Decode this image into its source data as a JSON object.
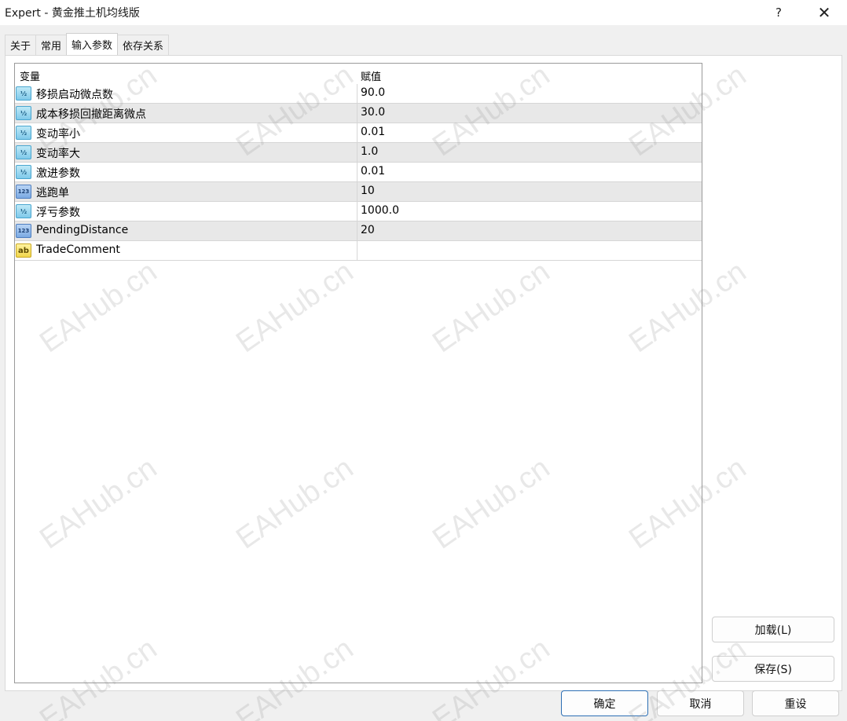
{
  "window": {
    "title": "Expert - 黄金推土机均线版",
    "help_label": "?",
    "close_label": "✕"
  },
  "tabs": [
    {
      "label": "关于"
    },
    {
      "label": "常用"
    },
    {
      "label": "输入参数",
      "active": true
    },
    {
      "label": "依存关系"
    }
  ],
  "grid": {
    "col_variable": "变量",
    "col_value": "赋值",
    "rows": [
      {
        "type": "double",
        "icon": "½",
        "name": "移损启动微点数",
        "value": "90.0"
      },
      {
        "type": "double",
        "icon": "½",
        "name": "成本移损回撤距离微点",
        "value": "30.0"
      },
      {
        "type": "double",
        "icon": "½",
        "name": "变动率小",
        "value": "0.01"
      },
      {
        "type": "double",
        "icon": "½",
        "name": "变动率大",
        "value": "1.0"
      },
      {
        "type": "double",
        "icon": "½",
        "name": "激进参数",
        "value": "0.01"
      },
      {
        "type": "int",
        "icon": "123",
        "name": "逃跑单",
        "value": "10"
      },
      {
        "type": "double",
        "icon": "½",
        "name": "浮亏参数",
        "value": "1000.0"
      },
      {
        "type": "int",
        "icon": "123",
        "name": "PendingDistance",
        "value": "20"
      },
      {
        "type": "string",
        "icon": "ab",
        "name": "TradeComment",
        "value": ""
      }
    ]
  },
  "buttons": {
    "load": "加载(L)",
    "save": "保存(S)",
    "ok": "确定",
    "cancel": "取消",
    "reset": "重设"
  },
  "watermark": "EAHub.cn"
}
